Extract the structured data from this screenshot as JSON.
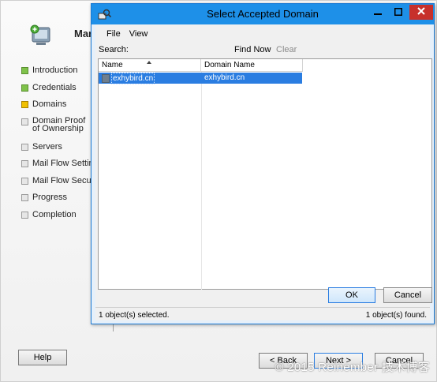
{
  "wizard": {
    "title": "Mar",
    "steps": [
      {
        "label": "Introduction",
        "state": "done"
      },
      {
        "label": "Credentials",
        "state": "done"
      },
      {
        "label": "Domains",
        "state": "current"
      },
      {
        "label": "Domain Proof of Ownership",
        "state": "pending"
      },
      {
        "label": "Servers",
        "state": "pending"
      },
      {
        "label": "Mail Flow Settings",
        "state": "pending"
      },
      {
        "label": "Mail Flow Securit",
        "state": "pending"
      },
      {
        "label": "Progress",
        "state": "pending"
      },
      {
        "label": "Completion",
        "state": "pending"
      }
    ],
    "buttons": {
      "help": "Help",
      "back": "< Back",
      "next": "Next >",
      "cancel": "Cancel"
    },
    "watermark": "© 2015 Reinember 技术博客"
  },
  "dialog": {
    "title": "Select Accepted Domain",
    "menu": [
      "File",
      "View"
    ],
    "search_label": "Search:",
    "search_value": "",
    "find_now": "Find Now",
    "clear": "Clear",
    "columns": [
      "Name",
      "Domain Name"
    ],
    "rows": [
      {
        "name": "exhybird.cn",
        "domain": "exhybird.cn",
        "selected": true
      }
    ],
    "ok": "OK",
    "cancel": "Cancel",
    "status_left": "1 object(s) selected.",
    "status_right": "1 object(s) found.",
    "colors": {
      "titlebar": "#1e90e8",
      "selection": "#2a7de1",
      "close": "#c7302b"
    }
  }
}
